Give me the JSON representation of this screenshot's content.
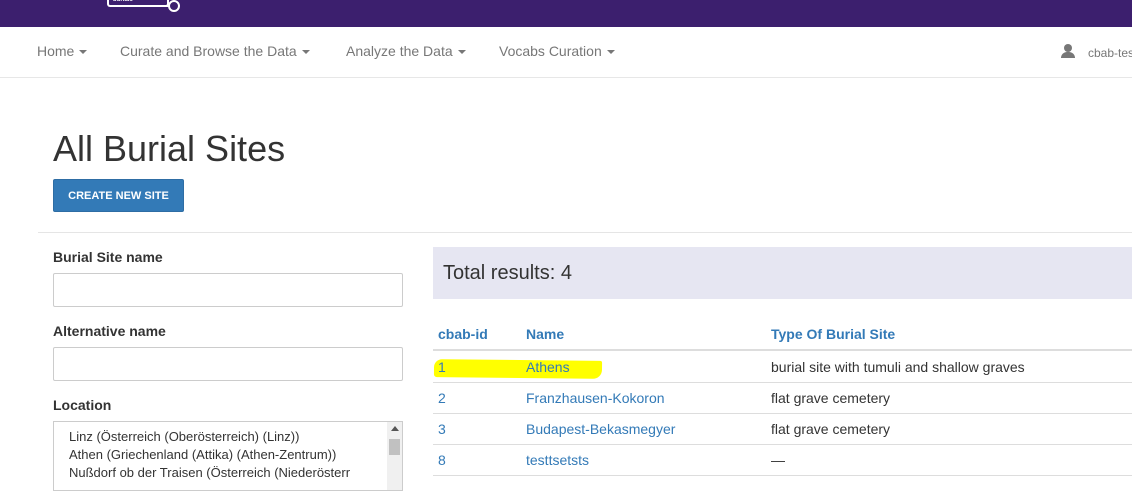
{
  "header": {
    "logo_text": "burials"
  },
  "nav": {
    "items": [
      {
        "label": "Home"
      },
      {
        "label": "Curate and Browse the Data"
      },
      {
        "label": "Analyze the Data"
      },
      {
        "label": "Vocabs Curation"
      }
    ],
    "user": "cbab-test"
  },
  "page": {
    "title": "All Burial Sites",
    "create_button": "CREATE NEW SITE"
  },
  "filters": {
    "site_name_label": "Burial Site name",
    "site_name_value": "",
    "alt_name_label": "Alternative name",
    "alt_name_value": "",
    "location_label": "Location",
    "location_options": [
      "Linz (Österreich (Oberösterreich) (Linz))",
      "Athen (Griechenland (Attika) (Athen-Zentrum))",
      "Nußdorf ob der Traisen (Österreich (Niederösterr"
    ]
  },
  "results": {
    "total_text": "Total results: 4",
    "columns": [
      "cbab-id",
      "Name",
      "Type Of Burial Site"
    ],
    "rows": [
      {
        "id": "1",
        "name": "Athens",
        "type": "burial site with tumuli and shallow graves"
      },
      {
        "id": "2",
        "name": "Franzhausen-Kokoron",
        "type": "flat grave cemetery"
      },
      {
        "id": "3",
        "name": "Budapest-Bekasmegyer",
        "type": "flat grave cemetery"
      },
      {
        "id": "8",
        "name": "testtsetsts",
        "type": "—"
      }
    ]
  },
  "colors": {
    "topbar": "#3c1f6e",
    "primary": "#337ab7",
    "highlight": "#ffff00"
  },
  "icons": {
    "user": "user-icon",
    "dropdown": "caret-down-icon"
  }
}
